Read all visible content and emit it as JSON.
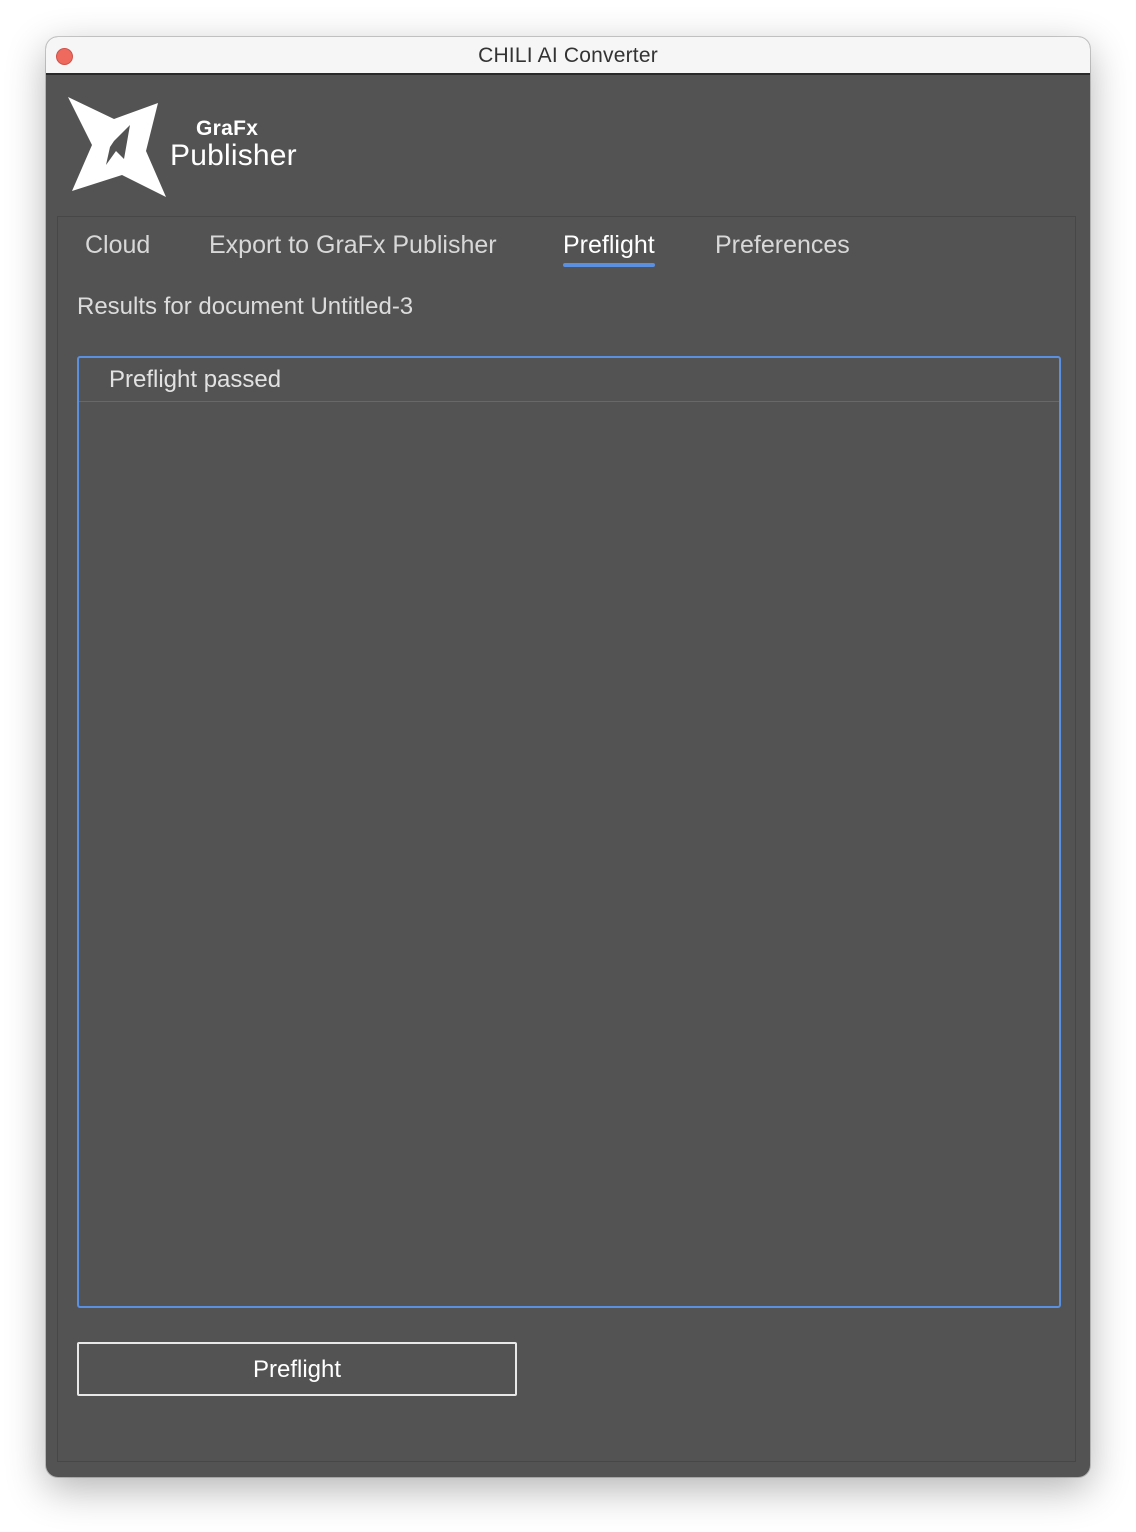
{
  "window": {
    "title": "CHILI AI Converter"
  },
  "logo": {
    "top_text": "GraFx",
    "main_text": "Publisher",
    "icon": "grafx-star-logo-icon"
  },
  "tabs": [
    {
      "label": "Cloud",
      "active": false
    },
    {
      "label": "Export to GraFx Publisher",
      "active": false
    },
    {
      "label": "Preflight",
      "active": true
    },
    {
      "label": "Preferences",
      "active": false
    }
  ],
  "preflight": {
    "results_label": "Results for document Untitled-3",
    "status": "Preflight passed",
    "button_label": "Preflight"
  },
  "colors": {
    "accent": "#5b8fe0",
    "background": "#535353",
    "close_button": "#ee6a5f"
  }
}
